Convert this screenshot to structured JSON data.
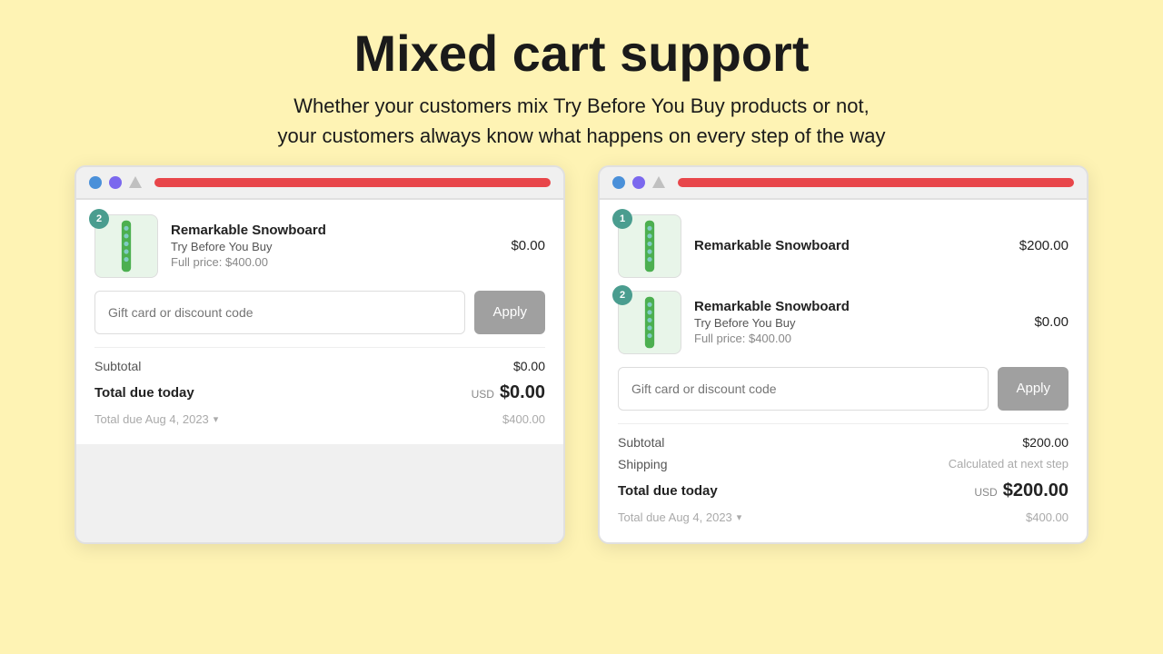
{
  "page": {
    "title": "Mixed cart support",
    "subtitle_line1": "Whether your customers mix Try Before You Buy products or not,",
    "subtitle_line2": "your customers always know what happens on every step of the way"
  },
  "cart_left": {
    "badge": "2",
    "product": {
      "name": "Remarkable Snowboard",
      "tag": "Try Before You Buy",
      "full_price": "Full price: $400.00",
      "price": "$0.00"
    },
    "discount_placeholder": "Gift card or discount code",
    "apply_label": "Apply",
    "subtotal_label": "Subtotal",
    "subtotal_value": "$0.00",
    "total_label": "Total due today",
    "total_currency": "USD",
    "total_amount": "$0.00",
    "future_label": "Total due Aug 4, 2023",
    "future_value": "$400.00"
  },
  "cart_right": {
    "badge1": "1",
    "product1": {
      "name": "Remarkable Snowboard",
      "price": "$200.00"
    },
    "badge2": "2",
    "product2": {
      "name": "Remarkable Snowboard",
      "tag": "Try Before You Buy",
      "full_price": "Full price: $400.00",
      "price": "$0.00"
    },
    "discount_placeholder": "Gift card or discount code",
    "apply_label": "Apply",
    "subtotal_label": "Subtotal",
    "subtotal_value": "$200.00",
    "shipping_label": "Shipping",
    "shipping_value": "Calculated at next step",
    "total_label": "Total due today",
    "total_currency": "USD",
    "total_amount": "$200.00",
    "future_label": "Total due Aug 4, 2023",
    "future_value": "$400.00"
  }
}
